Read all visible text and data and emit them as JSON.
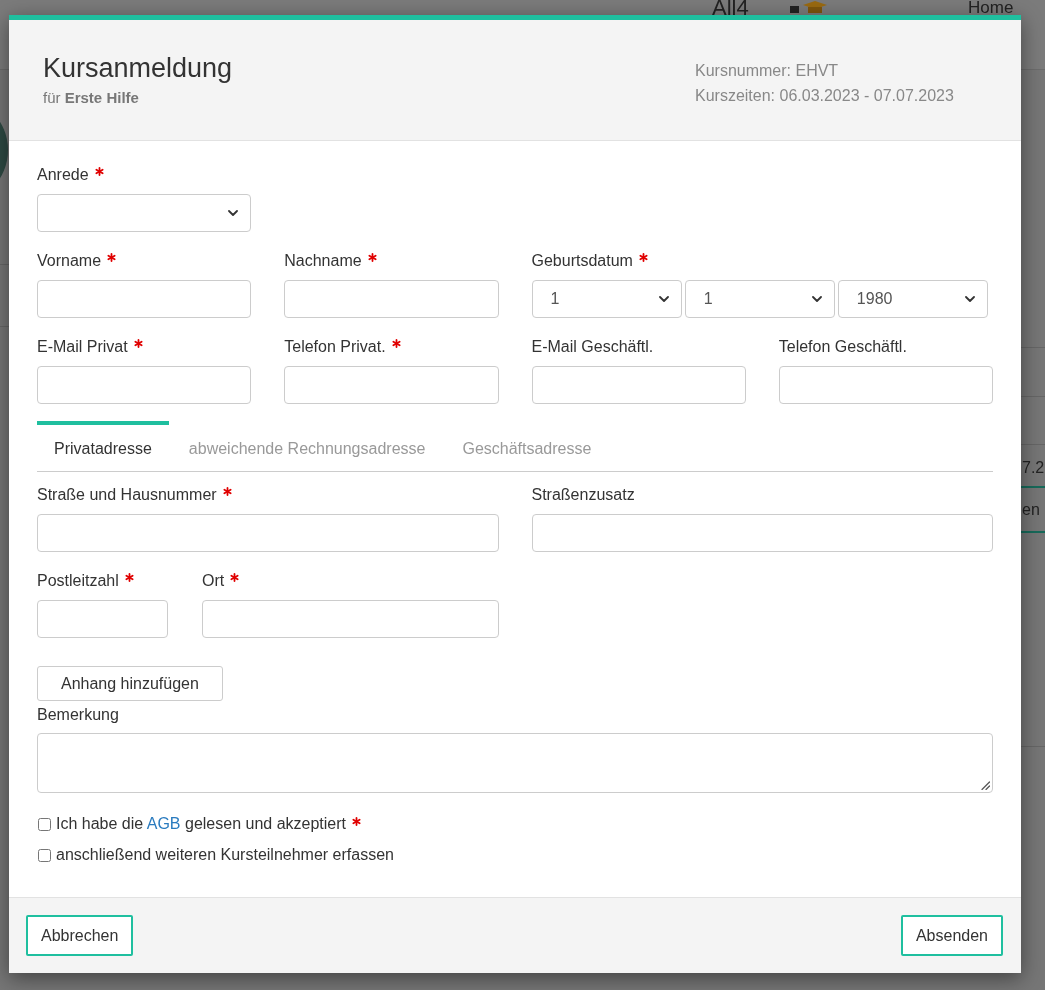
{
  "background": {
    "logo": "All4",
    "nav_link": "Home",
    "cell_fragment": "7.2",
    "button_fragment": "en"
  },
  "dialog": {
    "title": "Kursanmeldung",
    "subtitle": "für **Erste Hilfe**",
    "info": [
      "Kursnummer: EHVT",
      "Kurszeiten: 06.03.2023 - 07.07.2023"
    ]
  },
  "personal_rows": [
    [
      {
        "kind": "select",
        "label": "Anrede",
        "required": true
      }
    ],
    [
      {
        "kind": "text",
        "label": "Vorname",
        "required": true
      },
      {
        "kind": "text",
        "label": "Nachname",
        "required": true
      },
      {
        "kind": "date",
        "label": "Geburtsdatum",
        "required": true,
        "parts": [
          "1",
          "1",
          "1980"
        ]
      }
    ],
    [
      {
        "kind": "text",
        "label": "E-Mail Privat",
        "required": true
      },
      {
        "kind": "text",
        "label": "Telefon Privat.",
        "required": true
      },
      {
        "kind": "text",
        "label": "E-Mail Geschäftl.",
        "required": false
      },
      {
        "kind": "text",
        "label": "Telefon Geschäftl.",
        "required": false
      }
    ]
  ],
  "address": {
    "tabs": [
      {
        "label": "Privatadresse",
        "selected": true
      },
      {
        "label": "abweichende Rechnungsadresse",
        "selected": false
      },
      {
        "label": "Geschäftsadresse",
        "selected": false
      }
    ],
    "fields": [
      {
        "label": "Straße und Hausnummer",
        "required": true
      },
      {
        "label": "Straßenzusatz",
        "required": false
      },
      {
        "label": "Postleitzahl",
        "required": true
      },
      {
        "label": "Ort",
        "required": true
      }
    ]
  },
  "attachment_button": "Anhang hinzufügen",
  "remark": {
    "label": "Bemerkung"
  },
  "consents": [
    {
      "before": "Ich habe die",
      "link": "AGB",
      "after": "gelesen und akzeptiert",
      "required": true,
      "checked": false
    },
    {
      "before": "anschließend weiteren Kursteilnehmer erfassen",
      "required": false,
      "checked": false
    }
  ],
  "footer_buttons": [
    "Abbrechen",
    "Absenden"
  ]
}
